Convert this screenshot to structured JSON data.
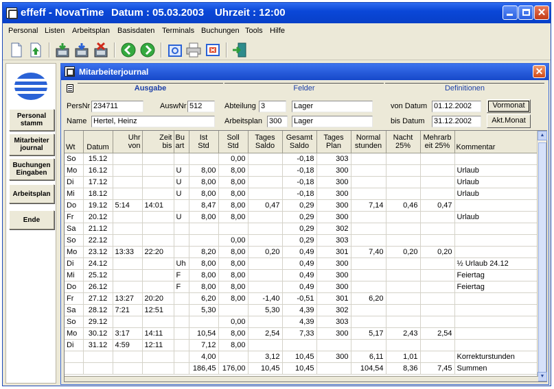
{
  "window": {
    "app_name": "effeff - NovaTime",
    "date_text": "Datum : 05.03.2003",
    "time_text": "Uhrzeit : 12:00"
  },
  "menu": [
    "Personal",
    "Listen",
    "Arbeitsplan",
    "Basisdaten",
    "Terminals",
    "Buchungen",
    "Tools",
    "Hilfe"
  ],
  "toolbar_icons": [
    "new-document-icon",
    "upload-icon",
    "download-icon",
    "import-icon",
    "delete-icon",
    "back-icon",
    "forward-icon",
    "settings-icon",
    "print-icon",
    "close-report-icon",
    "exit-icon"
  ],
  "leftnav": {
    "items": [
      {
        "line1": "Personal",
        "line2": "stamm"
      },
      {
        "line1": "Mitarbeiter",
        "line2": "journal"
      },
      {
        "line1": "Buchungen",
        "line2": "Eingaben"
      },
      {
        "line1": "Arbeitsplan",
        "line2": ""
      },
      {
        "line1": "Ende",
        "line2": ""
      }
    ]
  },
  "journal": {
    "title": "Mitarbeiterjournal",
    "tabs": [
      "Ausgabe",
      "Felder",
      "Definitionen"
    ],
    "active_tab": "Ausgabe",
    "form": {
      "persnr_label": "PersNr",
      "persnr": "234711",
      "auswnr_label": "AuswNr",
      "auswnr": "512",
      "name_label": "Name",
      "name": "Hertel, Heinz",
      "abteilung_label": "Abteilung",
      "abteilung_nr": "3",
      "abteilung_name": "Lager",
      "arbeitsplan_label": "Arbeitsplan",
      "arbeitsplan_nr": "300",
      "arbeitsplan_name": "Lager",
      "von_datum_label": "von Datum",
      "von_datum": "01.12.2002",
      "bis_datum_label": "bis Datum",
      "bis_datum": "31.12.2002",
      "vormonat_button": "Vormonat",
      "aktmonat_button": "Akt.Monat"
    },
    "columns": [
      {
        "l1": "",
        "l2": "Wt"
      },
      {
        "l1": "",
        "l2": "Datum"
      },
      {
        "l1": "Uhr",
        "l2": "von"
      },
      {
        "l1": "Zeit",
        "l2": "bis"
      },
      {
        "l1": "Bu",
        "l2": "art"
      },
      {
        "l1": "Ist",
        "l2": "Std"
      },
      {
        "l1": "Soll",
        "l2": "Std"
      },
      {
        "l1": "Tages",
        "l2": "Saldo"
      },
      {
        "l1": "Gesamt",
        "l2": "Saldo"
      },
      {
        "l1": "Tages",
        "l2": "Plan"
      },
      {
        "l1": "Normal",
        "l2": "stunden"
      },
      {
        "l1": "Nacht",
        "l2": "25%"
      },
      {
        "l1": "Mehrarb",
        "l2": "eit 25%"
      },
      {
        "l1": "",
        "l2": "Kommentar"
      }
    ],
    "rows": [
      [
        "So",
        "15.12",
        "",
        "",
        "",
        "",
        "0,00",
        "",
        "-0,18",
        "303",
        "",
        "",
        "",
        ""
      ],
      [
        "Mo",
        "16.12",
        "",
        "",
        "U",
        "8,00",
        "8,00",
        "",
        "-0,18",
        "300",
        "",
        "",
        "",
        "Urlaub"
      ],
      [
        "Di",
        "17.12",
        "",
        "",
        "U",
        "8,00",
        "8,00",
        "",
        "-0,18",
        "300",
        "",
        "",
        "",
        "Urlaub"
      ],
      [
        "Mi",
        "18.12",
        "",
        "",
        "U",
        "8,00",
        "8,00",
        "",
        "-0,18",
        "300",
        "",
        "",
        "",
        "Urlaub"
      ],
      [
        "Do",
        "19.12",
        "5:14",
        "14:01",
        "",
        "8,47",
        "8,00",
        "0,47",
        "0,29",
        "300",
        "7,14",
        "0,46",
        "0,47",
        ""
      ],
      [
        "Fr",
        "20.12",
        "",
        "",
        "U",
        "8,00",
        "8,00",
        "",
        "0,29",
        "300",
        "",
        "",
        "",
        "Urlaub"
      ],
      [
        "Sa",
        "21.12",
        "",
        "",
        "",
        "",
        "",
        "",
        "0,29",
        "302",
        "",
        "",
        "",
        ""
      ],
      [
        "So",
        "22.12",
        "",
        "",
        "",
        "",
        "0,00",
        "",
        "0,29",
        "303",
        "",
        "",
        "",
        ""
      ],
      [
        "Mo",
        "23.12",
        "13:33",
        "22:20",
        "",
        "8,20",
        "8,00",
        "0,20",
        "0,49",
        "301",
        "7,40",
        "0,20",
        "0,20",
        ""
      ],
      [
        "Di",
        "24.12",
        "",
        "",
        "Uh",
        "8,00",
        "8,00",
        "",
        "0,49",
        "300",
        "",
        "",
        "",
        "½ Urlaub 24.12"
      ],
      [
        "Mi",
        "25.12",
        "",
        "",
        "F",
        "8,00",
        "8,00",
        "",
        "0,49",
        "300",
        "",
        "",
        "",
        "Feiertag"
      ],
      [
        "Do",
        "26.12",
        "",
        "",
        "F",
        "8,00",
        "8,00",
        "",
        "0,49",
        "300",
        "",
        "",
        "",
        "Feiertag"
      ],
      [
        "Fr",
        "27.12",
        "13:27",
        "20:20",
        "",
        "6,20",
        "8,00",
        "-1,40",
        "-0,51",
        "301",
        "6,20",
        "",
        "",
        ""
      ],
      [
        "Sa",
        "28.12",
        "7:21",
        "12:51",
        "",
        "5,30",
        "",
        "5,30",
        "4,39",
        "302",
        "",
        "",
        "",
        ""
      ],
      [
        "So",
        "29.12",
        "",
        "",
        "",
        "",
        "0,00",
        "",
        "4,39",
        "303",
        "",
        "",
        "",
        ""
      ],
      [
        "Mo",
        "30.12",
        "3:17",
        "14:11",
        "",
        "10,54",
        "8,00",
        "2,54",
        "7,33",
        "300",
        "5,17",
        "2,43",
        "2,54",
        ""
      ],
      [
        "Di",
        "31.12",
        "4:59",
        "12:11",
        "",
        "7,12",
        "8,00",
        "",
        "",
        "",
        "",
        "",
        "",
        ""
      ],
      [
        "",
        "",
        "",
        "",
        "",
        "4,00",
        "",
        "3,12",
        "10,45",
        "300",
        "6,11",
        "1,01",
        "",
        "Korrekturstunden"
      ],
      [
        "",
        "",
        "",
        "",
        "",
        "186,45",
        "176,00",
        "10,45",
        "10,45",
        "",
        "104,54",
        "8,36",
        "7,45",
        "Summen"
      ]
    ]
  },
  "colors": {
    "titlebar": "#0a47d8",
    "window_bg": "#ece9d8",
    "tab_text": "#1c3fa8"
  }
}
